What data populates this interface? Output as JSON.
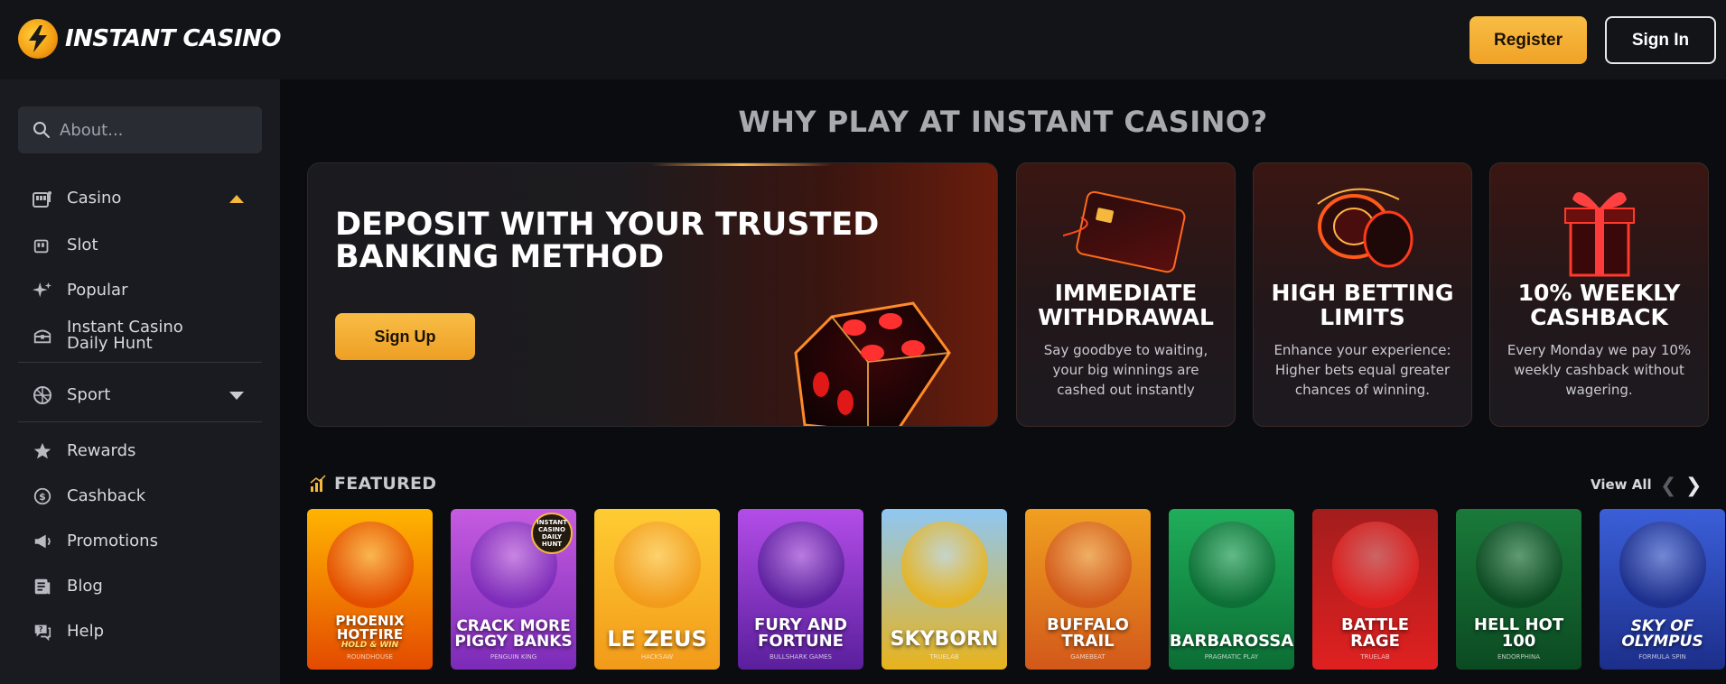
{
  "header": {
    "brand": "INSTANT CASINO",
    "register_label": "Register",
    "signin_label": "Sign In"
  },
  "sidebar": {
    "search_placeholder": "About...",
    "items": [
      {
        "label": "Casino",
        "icon": "slot-machine-icon"
      },
      {
        "label": "Slot",
        "icon": "slot-icon"
      },
      {
        "label": "Popular",
        "icon": "sparkle-icon"
      },
      {
        "label": "Instant Casino Daily Hunt",
        "icon": "treasure-icon"
      },
      {
        "label": "Sport",
        "icon": "sport-icon"
      },
      {
        "label": "Rewards",
        "icon": "star-icon"
      },
      {
        "label": "Cashback",
        "icon": "cashback-icon"
      },
      {
        "label": "Promotions",
        "icon": "megaphone-icon"
      },
      {
        "label": "Blog",
        "icon": "blog-icon"
      },
      {
        "label": "Help",
        "icon": "help-icon"
      }
    ]
  },
  "main": {
    "title": "WHY PLAY AT INSTANT CASINO?",
    "hero": {
      "title": "DEPOSIT WITH YOUR TRUSTED BANKING METHOD",
      "button_label": "Sign Up"
    },
    "features": [
      {
        "title": "IMMEDIATE WITHDRAWAL",
        "desc": "Say goodbye to waiting, your big winnings are cashed out instantly"
      },
      {
        "title": "HIGH BETTING LIMITS",
        "desc": "Enhance your experience: Higher bets equal greater chances of winning."
      },
      {
        "title": "10% WEEKLY CASHBACK",
        "desc": "Every Monday we pay 10% weekly cashback without wagering."
      }
    ],
    "featured": {
      "label": "FEATURED",
      "view_all": "View All",
      "games": [
        {
          "title": "PHOENIX HOTFIRE",
          "subtitle": "HOLD & WIN",
          "provider": "ROUNDHOUSE",
          "colors": [
            "#ffb400",
            "#e34a00"
          ]
        },
        {
          "title": "CRACK MORE PIGGY BANKS",
          "subtitle": "",
          "provider": "PENGUIN KING",
          "colors": [
            "#c65be0",
            "#7b2bb8"
          ],
          "badge": "INSTANT CASINO DAILY HUNT"
        },
        {
          "title": "LE ZEUS",
          "subtitle": "",
          "provider": "HACKSAW",
          "colors": [
            "#ffcc33",
            "#f29a1a"
          ]
        },
        {
          "title": "FURY AND FORTUNE",
          "subtitle": "",
          "provider": "BULLSHARK GAMES",
          "colors": [
            "#b34de8",
            "#5a1f9c"
          ]
        },
        {
          "title": "SKYBORN",
          "subtitle": "",
          "provider": "TRUELAB",
          "colors": [
            "#8fc7f2",
            "#e8b31c"
          ]
        },
        {
          "title": "BUFFALO TRAIL",
          "subtitle": "",
          "provider": "GAMEBEAT",
          "colors": [
            "#f0a020",
            "#d2581a"
          ]
        },
        {
          "title": "BARBAROSSA",
          "subtitle": "",
          "provider": "PRAGMATIC PLAY",
          "colors": [
            "#1fae5a",
            "#0c6d34"
          ]
        },
        {
          "title": "BATTLE RAGE",
          "subtitle": "",
          "provider": "TRUELAB",
          "colors": [
            "#a31d1d",
            "#e02020"
          ]
        },
        {
          "title": "HELL HOT 100",
          "subtitle": "",
          "provider": "ENDORPHINA",
          "colors": [
            "#1a7a3a",
            "#0c4a22"
          ]
        },
        {
          "title": "SKY OF OLYMPUS",
          "subtitle": "",
          "provider": "FORMULA SPIN",
          "colors": [
            "#3b5fd9",
            "#1c2e8a"
          ]
        }
      ]
    }
  },
  "colors": {
    "accent": "#f5b73c",
    "background": "#0b0c0f",
    "sidebar": "#1a1b20",
    "header": "#131418"
  }
}
